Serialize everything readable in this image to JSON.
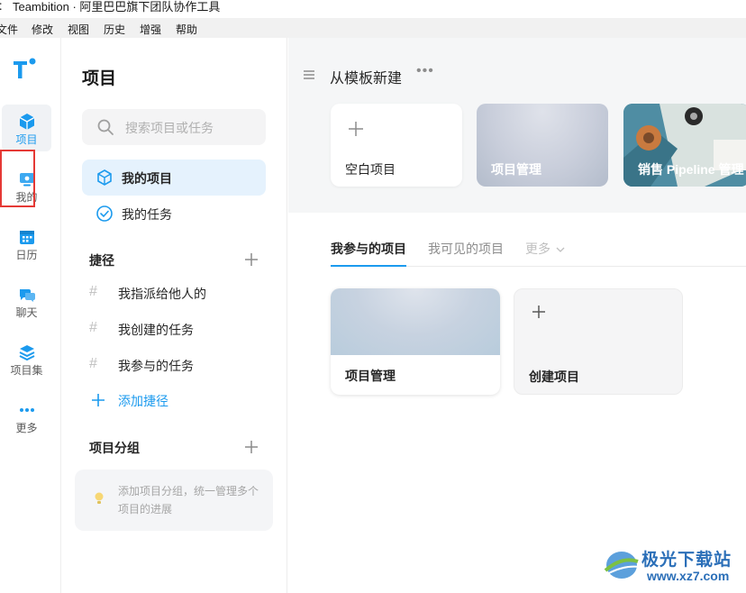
{
  "window": {
    "title": "Teambition · 阿里巴巴旗下团队协作工具"
  },
  "menubar": [
    "文件",
    "修改",
    "视图",
    "历史",
    "增强",
    "帮助"
  ],
  "rail": {
    "items": [
      {
        "label": "项目",
        "icon": "project-icon",
        "active": true
      },
      {
        "label": "我的",
        "icon": "mine-icon",
        "active": false
      },
      {
        "label": "日历",
        "icon": "calendar-icon",
        "active": false
      },
      {
        "label": "聊天",
        "icon": "chat-icon",
        "active": false
      },
      {
        "label": "项目集",
        "icon": "project-set-icon",
        "active": false
      },
      {
        "label": "更多",
        "icon": "more-icon",
        "active": false
      }
    ],
    "highlight_color": "#e53935"
  },
  "sidebar": {
    "title": "项目",
    "search_placeholder": "搜索项目或任务",
    "nav": [
      {
        "label": "我的项目",
        "icon": "cube-icon",
        "active": true
      },
      {
        "label": "我的任务",
        "icon": "check-circle-icon",
        "active": false
      }
    ],
    "shortcuts": {
      "title": "捷径",
      "items": [
        "我指派给他人的",
        "我创建的任务",
        "我参与的任务"
      ],
      "add_label": "添加捷径"
    },
    "groups": {
      "title": "项目分组",
      "hint": "添加项目分组，统一管理多个项目的进展"
    }
  },
  "templates": {
    "title": "从模板新建",
    "cards": [
      "空白项目",
      "项目管理",
      "销售 Pipeline 管理"
    ]
  },
  "tabs": {
    "items": [
      "我参与的项目",
      "我可见的项目",
      "更多"
    ],
    "active": 0
  },
  "projects": {
    "project_card": "项目管理",
    "create_card": "创建项目"
  },
  "watermark": {
    "brand": "极光下载站",
    "url": "www.xz7.com"
  },
  "colors": {
    "accent": "#1b9aee",
    "active_nav_bg": "#e5f2fd"
  }
}
